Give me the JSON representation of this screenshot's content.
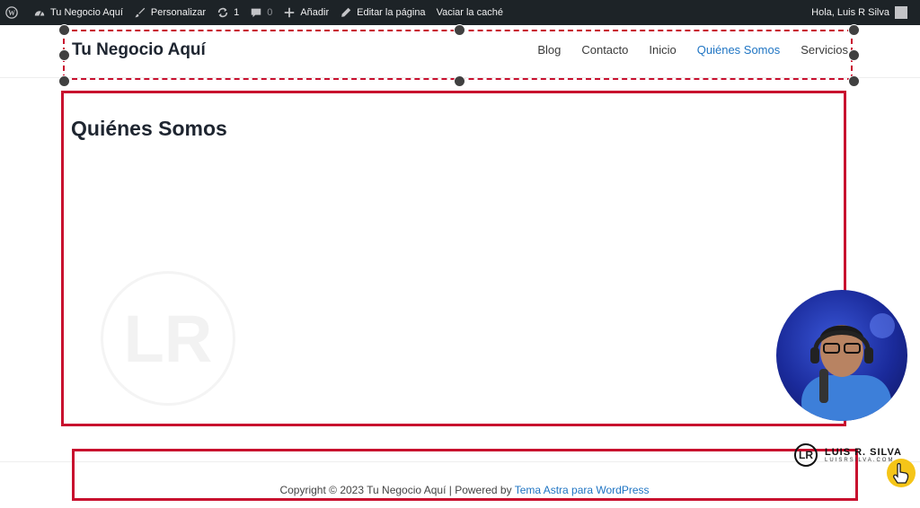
{
  "admin_bar": {
    "site_name": "Tu Negocio Aquí",
    "customize": "Personalizar",
    "updates": "1",
    "comments": "0",
    "add_new": "Añadir",
    "edit_page": "Editar la página",
    "clear_cache": "Vaciar la caché",
    "greeting": "Hola, Luis R Silva"
  },
  "header": {
    "site_title": "Tu Negocio Aquí",
    "nav": [
      "Blog",
      "Contacto",
      "Inicio",
      "Quiénes Somos",
      "Servicios"
    ],
    "active_nav": "Quiénes Somos"
  },
  "content": {
    "page_title": "Quiénes Somos"
  },
  "footer": {
    "copyright": "Copyright © 2023 Tu Negocio Aquí | Powered by ",
    "link": "Tema Astra para WordPress"
  },
  "overlay": {
    "brand_name": "LUIS R. SILVA",
    "brand_url": "LUISRSILVA.COM",
    "logo_letters": "LR"
  },
  "colors": {
    "accent": "#1e74c3",
    "selection": "#c8102e",
    "adminbar": "#1d2327"
  }
}
